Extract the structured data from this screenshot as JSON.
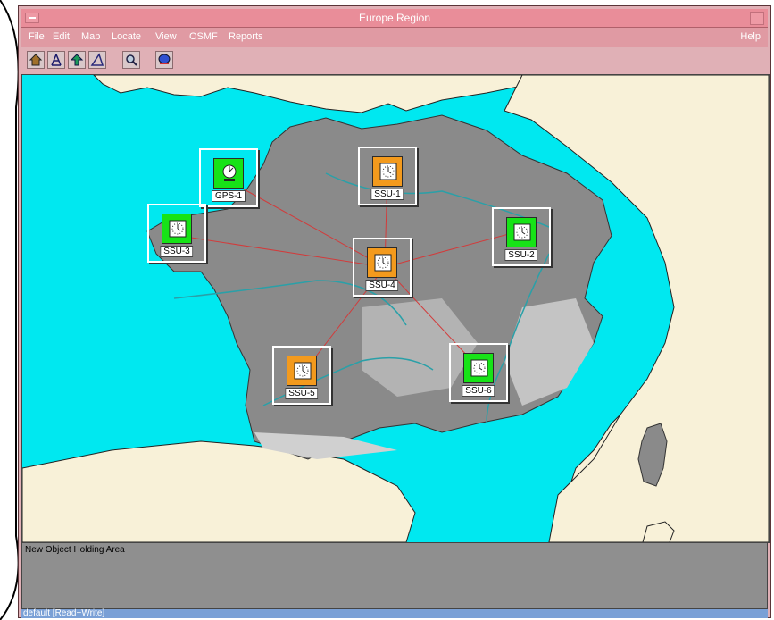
{
  "window": {
    "title": "Europe Region"
  },
  "menu": {
    "items": [
      {
        "label": "File",
        "key": "F"
      },
      {
        "label": "Edit",
        "key": "E"
      },
      {
        "label": "Map",
        "key": "M"
      },
      {
        "label": "Locate",
        "key": "L"
      },
      {
        "label": "View",
        "key": "V"
      },
      {
        "label": "OSMF",
        "key": "O"
      },
      {
        "label": "Reports",
        "key": "R"
      }
    ],
    "help": "Help"
  },
  "toolbar": {
    "buttons": [
      "home-icon",
      "network-icon",
      "up-arrow-icon",
      "triangle-tool-icon",
      "zoom-icon",
      "globe-icon"
    ]
  },
  "map": {
    "colors": {
      "sea": "#00e8f0",
      "land": "#f8f1d8",
      "france": "#8a8a8a",
      "link": "#d23b3b"
    },
    "nodes": [
      {
        "id": "GPS-1",
        "label": "GPS-1",
        "type": "gps",
        "status_color": "green"
      },
      {
        "id": "SSU-1",
        "label": "SSU-1",
        "type": "ssu",
        "status_color": "orange"
      },
      {
        "id": "SSU-3",
        "label": "SSU-3",
        "type": "ssu",
        "status_color": "green"
      },
      {
        "id": "SSU-4",
        "label": "SSU-4",
        "type": "ssu",
        "status_color": "orange"
      },
      {
        "id": "SSU-2",
        "label": "SSU-2",
        "type": "ssu",
        "status_color": "green"
      },
      {
        "id": "SSU-5",
        "label": "SSU-5",
        "type": "ssu",
        "status_color": "orange"
      },
      {
        "id": "SSU-6",
        "label": "SSU-6",
        "type": "ssu",
        "status_color": "green"
      }
    ],
    "links": [
      [
        "GPS-1",
        "SSU-4"
      ],
      [
        "SSU-3",
        "SSU-4"
      ],
      [
        "SSU-1",
        "SSU-4"
      ],
      [
        "SSU-2",
        "SSU-4"
      ],
      [
        "SSU-5",
        "SSU-4"
      ],
      [
        "SSU-6",
        "SSU-4"
      ]
    ]
  },
  "holding_area": {
    "label": "New Object Holding Area"
  },
  "status": {
    "text": "default [Read−Write]"
  }
}
